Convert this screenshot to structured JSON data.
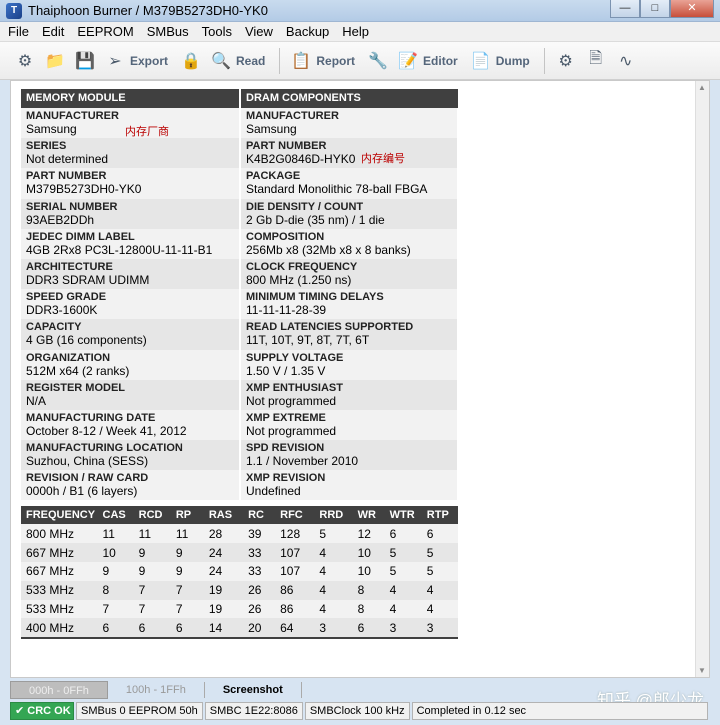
{
  "window": {
    "title": "Thaiphoon Burner / M379B5273DH0-YK0",
    "app_icon_glyph": "T"
  },
  "menu": [
    "File",
    "Edit",
    "EEPROM",
    "SMBus",
    "Tools",
    "View",
    "Backup",
    "Help"
  ],
  "toolbar": {
    "export_label": "Export",
    "read_label": "Read",
    "report_label": "Report",
    "editor_label": "Editor",
    "dump_label": "Dump"
  },
  "memory_module": {
    "header": "MEMORY MODULE",
    "fields": [
      {
        "label": "MANUFACTURER",
        "value": "Samsung"
      },
      {
        "label": "SERIES",
        "value": "Not determined"
      },
      {
        "label": "PART NUMBER",
        "value": "M379B5273DH0-YK0"
      },
      {
        "label": "SERIAL NUMBER",
        "value": "93AEB2DDh"
      },
      {
        "label": "JEDEC DIMM LABEL",
        "value": "4GB 2Rx8 PC3L-12800U-11-11-B1"
      },
      {
        "label": "ARCHITECTURE",
        "value": "DDR3 SDRAM UDIMM"
      },
      {
        "label": "SPEED GRADE",
        "value": "DDR3-1600K"
      },
      {
        "label": "CAPACITY",
        "value": "4 GB (16 components)"
      },
      {
        "label": "ORGANIZATION",
        "value": "512M x64 (2 ranks)"
      },
      {
        "label": "REGISTER MODEL",
        "value": "N/A"
      },
      {
        "label": "MANUFACTURING DATE",
        "value": "October 8-12 / Week 41, 2012"
      },
      {
        "label": "MANUFACTURING LOCATION",
        "value": "Suzhou, China (SESS)"
      },
      {
        "label": "REVISION / RAW CARD",
        "value": "0000h / B1 (6 layers)"
      }
    ]
  },
  "dram_components": {
    "header": "DRAM COMPONENTS",
    "fields": [
      {
        "label": "MANUFACTURER",
        "value": "Samsung"
      },
      {
        "label": "PART NUMBER",
        "value": "K4B2G0846D-HYK0"
      },
      {
        "label": "PACKAGE",
        "value": "Standard Monolithic 78-ball FBGA"
      },
      {
        "label": "DIE DENSITY / COUNT",
        "value": "2 Gb D-die (35 nm) / 1 die"
      },
      {
        "label": "COMPOSITION",
        "value": "256Mb x8 (32Mb x8 x 8 banks)"
      },
      {
        "label": "CLOCK FREQUENCY",
        "value": "800 MHz (1.250 ns)"
      },
      {
        "label": "MINIMUM TIMING DELAYS",
        "value": "11-11-11-28-39"
      },
      {
        "label": "READ LATENCIES SUPPORTED",
        "value": "11T, 10T, 9T, 8T, 7T, 6T"
      },
      {
        "label": "SUPPLY VOLTAGE",
        "value": "1.50 V / 1.35 V"
      },
      {
        "label": "XMP ENTHUSIAST",
        "value": "Not programmed"
      },
      {
        "label": "XMP EXTREME",
        "value": "Not programmed"
      },
      {
        "label": "SPD REVISION",
        "value": "1.1 / November 2010"
      },
      {
        "label": "XMP REVISION",
        "value": "Undefined"
      }
    ]
  },
  "annotations": {
    "manufacturer_note": "内存厂商",
    "part_number_note": "内存编号"
  },
  "timing_table": {
    "headers": [
      "FREQUENCY",
      "CAS",
      "RCD",
      "RP",
      "RAS",
      "RC",
      "RFC",
      "RRD",
      "WR",
      "WTR",
      "RTP"
    ],
    "rows": [
      [
        "800 MHz",
        "11",
        "11",
        "11",
        "28",
        "39",
        "128",
        "5",
        "12",
        "6",
        "6"
      ],
      [
        "667 MHz",
        "10",
        "9",
        "9",
        "24",
        "33",
        "107",
        "4",
        "10",
        "5",
        "5"
      ],
      [
        "667 MHz",
        "9",
        "9",
        "9",
        "24",
        "33",
        "107",
        "4",
        "10",
        "5",
        "5"
      ],
      [
        "533 MHz",
        "8",
        "7",
        "7",
        "19",
        "26",
        "86",
        "4",
        "8",
        "4",
        "4"
      ],
      [
        "533 MHz",
        "7",
        "7",
        "7",
        "19",
        "26",
        "86",
        "4",
        "8",
        "4",
        "4"
      ],
      [
        "400 MHz",
        "6",
        "6",
        "6",
        "14",
        "20",
        "64",
        "3",
        "6",
        "3",
        "3"
      ]
    ]
  },
  "tabs": [
    "000h - 0FFh",
    "100h - 1FFh",
    "Screenshot"
  ],
  "status": {
    "crc": "CRC OK",
    "smbus": "SMBus 0 EEPROM 50h",
    "smbc": "SMBC 1E22:8086",
    "smbclock": "SMBClock 100 kHz",
    "completed": "Completed in 0.12 sec"
  },
  "watermark": "知乎 @郎少龙",
  "colors": {
    "crc_ok": "#34a653",
    "annotation": "#bb0000",
    "table_header": "#404040"
  }
}
